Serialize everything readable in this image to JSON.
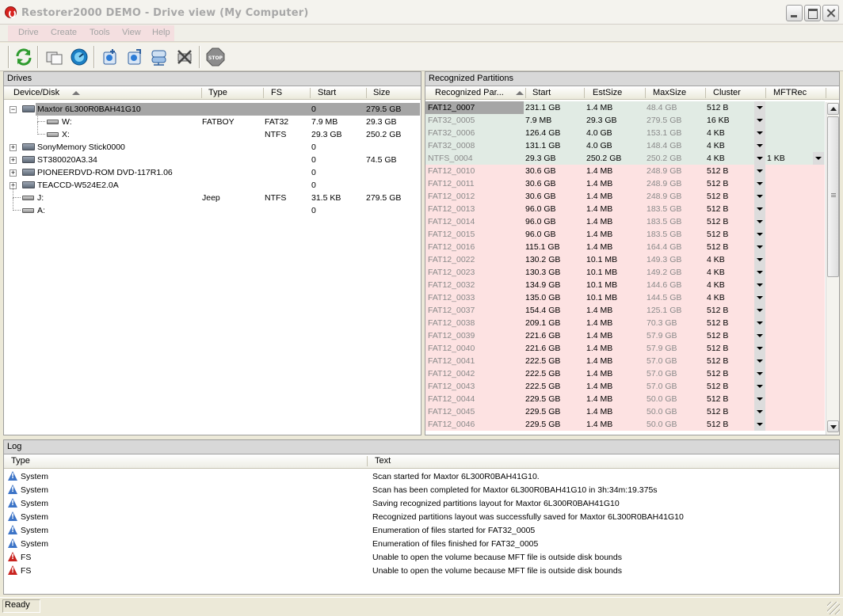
{
  "window": {
    "title": "Restorer2000 DEMO - Drive view (My Computer)"
  },
  "menu": [
    "Drive",
    "Create",
    "Tools",
    "View",
    "Help"
  ],
  "drives_panel": {
    "title": "Drives",
    "columns": [
      "Device/Disk",
      "Type",
      "FS",
      "Start",
      "Size"
    ],
    "rows": [
      {
        "name": "Maxtor 6L300R0BAH41G10",
        "type": "",
        "fs": "",
        "start": "0",
        "size": "279.5 GB",
        "level": 0,
        "expander": "−",
        "icon": "hard-disk-icon",
        "selected": true
      },
      {
        "name": "W:",
        "type": "FATBOY",
        "fs": "FAT32",
        "start": "7.9 MB",
        "size": "29.3 GB",
        "level": 1,
        "expander": "",
        "icon": "volume-icon",
        "selected": false
      },
      {
        "name": "X:",
        "type": "",
        "fs": "NTFS",
        "start": "29.3 GB",
        "size": "250.2 GB",
        "level": 1,
        "expander": "",
        "icon": "volume-icon",
        "selected": false
      },
      {
        "name": "SonyMemory Stick0000",
        "type": "",
        "fs": "",
        "start": "0",
        "size": "",
        "level": 0,
        "expander": "+",
        "icon": "hard-disk-icon",
        "selected": false
      },
      {
        "name": "ST380020A3.34",
        "type": "",
        "fs": "",
        "start": "0",
        "size": "74.5 GB",
        "level": 0,
        "expander": "+",
        "icon": "hard-disk-icon",
        "selected": false
      },
      {
        "name": "PIONEERDVD-ROM DVD-117R1.06",
        "type": "",
        "fs": "",
        "start": "0",
        "size": "",
        "level": 0,
        "expander": "+",
        "icon": "hard-disk-icon",
        "selected": false
      },
      {
        "name": "TEACCD-W524E2.0A",
        "type": "",
        "fs": "",
        "start": "0",
        "size": "",
        "level": 0,
        "expander": "+",
        "icon": "hard-disk-icon",
        "selected": false
      },
      {
        "name": "J:",
        "type": "Jeep",
        "fs": "NTFS",
        "start": "31.5 KB",
        "size": "279.5 GB",
        "level": 0,
        "expander": "",
        "icon": "volume-icon",
        "selected": false
      },
      {
        "name": "A:",
        "type": "",
        "fs": "",
        "start": "0",
        "size": "",
        "level": 0,
        "expander": "",
        "icon": "floppy-icon",
        "selected": false
      }
    ]
  },
  "partitions_panel": {
    "title": "Recognized Partitions",
    "columns": [
      "Recognized Par...",
      "Start",
      "EstSize",
      "MaxSize",
      "Cluster",
      "MFTRec"
    ],
    "rows": [
      {
        "name": "FAT12_0007",
        "start": "231.1 GB",
        "est": "1.4 MB",
        "max": "48.4 GB",
        "cluster": "512 B",
        "mft": "",
        "color": "green",
        "selected": true
      },
      {
        "name": "FAT32_0005",
        "start": "7.9 MB",
        "est": "29.3 GB",
        "max": "279.5 GB",
        "cluster": "16 KB",
        "mft": "",
        "color": "green",
        "selected": false
      },
      {
        "name": "FAT32_0006",
        "start": "126.4 GB",
        "est": "4.0 GB",
        "max": "153.1 GB",
        "cluster": "4 KB",
        "mft": "",
        "color": "green",
        "selected": false
      },
      {
        "name": "FAT32_0008",
        "start": "131.1 GB",
        "est": "4.0 GB",
        "max": "148.4 GB",
        "cluster": "4 KB",
        "mft": "",
        "color": "green",
        "selected": false
      },
      {
        "name": "NTFS_0004",
        "start": "29.3 GB",
        "est": "250.2 GB",
        "max": "250.2 GB",
        "cluster": "4 KB",
        "mft": "1 KB",
        "color": "green",
        "selected": false
      },
      {
        "name": "FAT12_0010",
        "start": "30.6 GB",
        "est": "1.4 MB",
        "max": "248.9 GB",
        "cluster": "512 B",
        "mft": "",
        "color": "red",
        "selected": false
      },
      {
        "name": "FAT12_0011",
        "start": "30.6 GB",
        "est": "1.4 MB",
        "max": "248.9 GB",
        "cluster": "512 B",
        "mft": "",
        "color": "red",
        "selected": false
      },
      {
        "name": "FAT12_0012",
        "start": "30.6 GB",
        "est": "1.4 MB",
        "max": "248.9 GB",
        "cluster": "512 B",
        "mft": "",
        "color": "red",
        "selected": false
      },
      {
        "name": "FAT12_0013",
        "start": "96.0 GB",
        "est": "1.4 MB",
        "max": "183.5 GB",
        "cluster": "512 B",
        "mft": "",
        "color": "red",
        "selected": false
      },
      {
        "name": "FAT12_0014",
        "start": "96.0 GB",
        "est": "1.4 MB",
        "max": "183.5 GB",
        "cluster": "512 B",
        "mft": "",
        "color": "red",
        "selected": false
      },
      {
        "name": "FAT12_0015",
        "start": "96.0 GB",
        "est": "1.4 MB",
        "max": "183.5 GB",
        "cluster": "512 B",
        "mft": "",
        "color": "red",
        "selected": false
      },
      {
        "name": "FAT12_0016",
        "start": "115.1 GB",
        "est": "1.4 MB",
        "max": "164.4 GB",
        "cluster": "512 B",
        "mft": "",
        "color": "red",
        "selected": false
      },
      {
        "name": "FAT12_0022",
        "start": "130.2 GB",
        "est": "10.1 MB",
        "max": "149.3 GB",
        "cluster": "4 KB",
        "mft": "",
        "color": "red",
        "selected": false
      },
      {
        "name": "FAT12_0023",
        "start": "130.3 GB",
        "est": "10.1 MB",
        "max": "149.2 GB",
        "cluster": "4 KB",
        "mft": "",
        "color": "red",
        "selected": false
      },
      {
        "name": "FAT12_0032",
        "start": "134.9 GB",
        "est": "10.1 MB",
        "max": "144.6 GB",
        "cluster": "4 KB",
        "mft": "",
        "color": "red",
        "selected": false
      },
      {
        "name": "FAT12_0033",
        "start": "135.0 GB",
        "est": "10.1 MB",
        "max": "144.5 GB",
        "cluster": "4 KB",
        "mft": "",
        "color": "red",
        "selected": false
      },
      {
        "name": "FAT12_0037",
        "start": "154.4 GB",
        "est": "1.4 MB",
        "max": "125.1 GB",
        "cluster": "512 B",
        "mft": "",
        "color": "red",
        "selected": false
      },
      {
        "name": "FAT12_0038",
        "start": "209.1 GB",
        "est": "1.4 MB",
        "max": "70.3 GB",
        "cluster": "512 B",
        "mft": "",
        "color": "red",
        "selected": false
      },
      {
        "name": "FAT12_0039",
        "start": "221.6 GB",
        "est": "1.4 MB",
        "max": "57.9 GB",
        "cluster": "512 B",
        "mft": "",
        "color": "red",
        "selected": false
      },
      {
        "name": "FAT12_0040",
        "start": "221.6 GB",
        "est": "1.4 MB",
        "max": "57.9 GB",
        "cluster": "512 B",
        "mft": "",
        "color": "red",
        "selected": false
      },
      {
        "name": "FAT12_0041",
        "start": "222.5 GB",
        "est": "1.4 MB",
        "max": "57.0 GB",
        "cluster": "512 B",
        "mft": "",
        "color": "red",
        "selected": false
      },
      {
        "name": "FAT12_0042",
        "start": "222.5 GB",
        "est": "1.4 MB",
        "max": "57.0 GB",
        "cluster": "512 B",
        "mft": "",
        "color": "red",
        "selected": false
      },
      {
        "name": "FAT12_0043",
        "start": "222.5 GB",
        "est": "1.4 MB",
        "max": "57.0 GB",
        "cluster": "512 B",
        "mft": "",
        "color": "red",
        "selected": false
      },
      {
        "name": "FAT12_0044",
        "start": "229.5 GB",
        "est": "1.4 MB",
        "max": "50.0 GB",
        "cluster": "512 B",
        "mft": "",
        "color": "red",
        "selected": false
      },
      {
        "name": "FAT12_0045",
        "start": "229.5 GB",
        "est": "1.4 MB",
        "max": "50.0 GB",
        "cluster": "512 B",
        "mft": "",
        "color": "red",
        "selected": false
      },
      {
        "name": "FAT12_0046",
        "start": "229.5 GB",
        "est": "1.4 MB",
        "max": "50.0 GB",
        "cluster": "512 B",
        "mft": "",
        "color": "red",
        "selected": false
      }
    ]
  },
  "log_panel": {
    "title": "Log",
    "columns": [
      "Type",
      "Text"
    ],
    "rows": [
      {
        "type": "System",
        "text": "Scan started for Maxtor 6L300R0BAH41G10.",
        "level": "info"
      },
      {
        "type": "System",
        "text": "Scan has been completed for Maxtor 6L300R0BAH41G10 in 3h:34m:19.375s",
        "level": "info"
      },
      {
        "type": "System",
        "text": "Saving recognized partitions layout for Maxtor 6L300R0BAH41G10",
        "level": "info"
      },
      {
        "type": "System",
        "text": "Recognized partitions layout was successfully saved for Maxtor 6L300R0BAH41G10",
        "level": "info"
      },
      {
        "type": "System",
        "text": "Enumeration of files started for FAT32_0005",
        "level": "info"
      },
      {
        "type": "System",
        "text": "Enumeration of files finished for FAT32_0005",
        "level": "info"
      },
      {
        "type": "FS",
        "text": "Unable to open the volume because MFT file is outside disk bounds",
        "level": "error"
      },
      {
        "type": "FS",
        "text": "Unable to open the volume because MFT file is outside disk bounds",
        "level": "error"
      }
    ]
  },
  "status": {
    "text": "Ready"
  },
  "colors": {
    "green_row": "#e1ebe4",
    "red_row": "#fde2e2",
    "selected_row": "#a6a6a6",
    "info_icon": "#3c74c7",
    "error_icon": "#c9231f"
  },
  "toolbar_icons": [
    "refresh-icon",
    "copy-icon",
    "scan-icon",
    "open-file-icon",
    "create-image-icon",
    "network-icon",
    "cancel-icon",
    "stop-icon"
  ]
}
